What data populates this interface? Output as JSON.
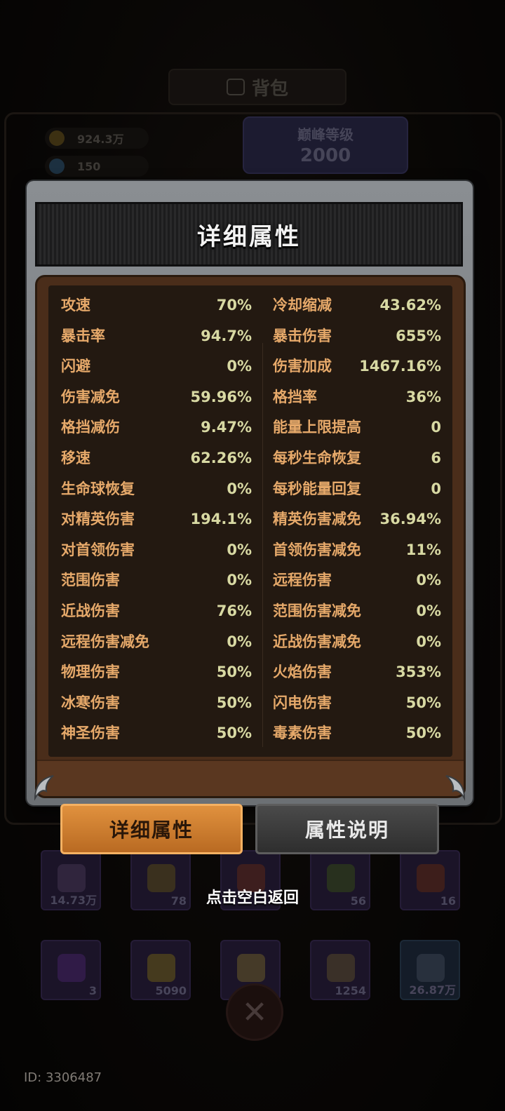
{
  "background": {
    "title": "背包",
    "gold": "924.3万",
    "gems": "150",
    "peak_label": "巅峰等级",
    "peak_level": "2000"
  },
  "modal": {
    "title": "详细属性",
    "stats_left": [
      {
        "label": "攻速",
        "value": "70%"
      },
      {
        "label": "暴击率",
        "value": "94.7%"
      },
      {
        "label": "闪避",
        "value": "0%"
      },
      {
        "label": "伤害减免",
        "value": "59.96%"
      },
      {
        "label": "格挡减伤",
        "value": "9.47%"
      },
      {
        "label": "移速",
        "value": "62.26%"
      },
      {
        "label": "生命球恢复",
        "value": "0%"
      },
      {
        "label": "对精英伤害",
        "value": "194.1%"
      },
      {
        "label": "对首领伤害",
        "value": "0%"
      },
      {
        "label": "范围伤害",
        "value": "0%"
      },
      {
        "label": "近战伤害",
        "value": "76%"
      },
      {
        "label": "远程伤害减免",
        "value": "0%"
      },
      {
        "label": "物理伤害",
        "value": "50%"
      },
      {
        "label": "冰寒伤害",
        "value": "50%"
      },
      {
        "label": "神圣伤害",
        "value": "50%"
      }
    ],
    "stats_right": [
      {
        "label": "冷却缩减",
        "value": "43.62%"
      },
      {
        "label": "暴击伤害",
        "value": "655%"
      },
      {
        "label": "伤害加成",
        "value": "1467.16%"
      },
      {
        "label": "格挡率",
        "value": "36%"
      },
      {
        "label": "能量上限提高",
        "value": "0"
      },
      {
        "label": "每秒生命恢复",
        "value": "6"
      },
      {
        "label": "每秒能量回复",
        "value": "0"
      },
      {
        "label": "精英伤害减免",
        "value": "36.94%"
      },
      {
        "label": "首领伤害减免",
        "value": "11%"
      },
      {
        "label": "远程伤害",
        "value": "0%"
      },
      {
        "label": "范围伤害减免",
        "value": "0%"
      },
      {
        "label": "近战伤害减免",
        "value": "0%"
      },
      {
        "label": "火焰伤害",
        "value": "353%"
      },
      {
        "label": "闪电伤害",
        "value": "50%"
      },
      {
        "label": "毒素伤害",
        "value": "50%"
      }
    ]
  },
  "tabs": {
    "detail": "详细属性",
    "explain": "属性说明"
  },
  "hint": "点击空白返回",
  "items_row1": [
    "14.73万",
    "78",
    "",
    "56",
    "16"
  ],
  "items_row2": [
    "3",
    "5090",
    "",
    "1254",
    "26.87万"
  ],
  "user_id": "ID: 3306487",
  "colors": {
    "stat_label": "#e6a96a",
    "stat_value": "#d8d9a3",
    "primary_button": "#d98a3a"
  }
}
